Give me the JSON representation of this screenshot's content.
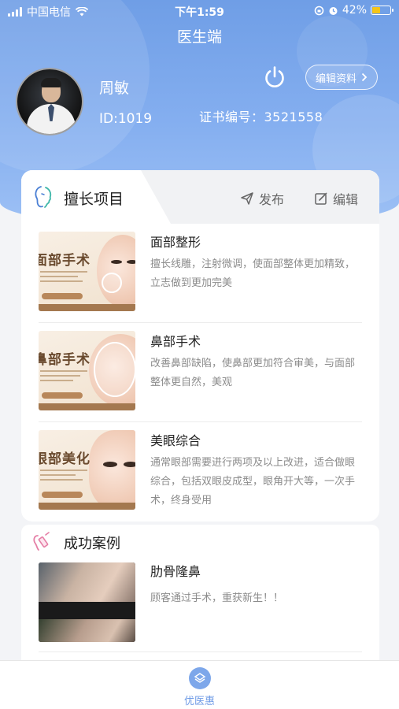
{
  "status_bar": {
    "carrier": "中国电信",
    "time": "下午1:59",
    "battery_text": "42%",
    "battery_level": 0.42,
    "battery_color": "#f5c518"
  },
  "header": {
    "title": "医生端",
    "accent_color": "#7aa6ea"
  },
  "profile": {
    "name": "周敏",
    "id_text": "ID:1019",
    "certificate_text": "证书编号：3521558",
    "edit_label": "编辑资料",
    "power_icon": "power-icon"
  },
  "skills": {
    "tab_label": "擅长项目",
    "publish_label": "发布",
    "edit_label": "编辑",
    "items": [
      {
        "title": "面部整形",
        "description": "擅长线雕，注射微调，使面部整体更加精致，立志做到更加完美",
        "thumb_title": "面部手术"
      },
      {
        "title": "鼻部手术",
        "description": "改善鼻部缺陷，使鼻部更加符合审美，与面部整体更自然，美观",
        "thumb_title": "鼻部手术"
      },
      {
        "title": "美眼综合",
        "description": "通常眼部需要进行两项及以上改进，适合做眼综合，包括双眼皮成型，眼角开大等，一次手术，终身受用",
        "thumb_title": "眼部美化"
      }
    ]
  },
  "cases": {
    "label": "成功案例",
    "items": [
      {
        "title": "肋骨隆鼻",
        "description": "顾客通过手术，重获新生！！"
      }
    ]
  },
  "bottom_nav": {
    "items": [
      {
        "label": "优医惠",
        "icon": "app-logo-icon"
      }
    ]
  }
}
